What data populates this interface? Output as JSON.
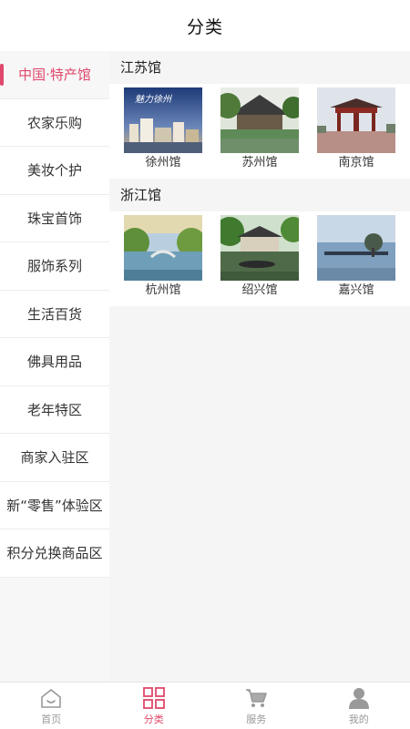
{
  "header": {
    "title": "分类"
  },
  "sidebar": {
    "items": [
      {
        "label": "中国·特产馆",
        "active": true
      },
      {
        "label": "农家乐购"
      },
      {
        "label": "美妆个护"
      },
      {
        "label": "珠宝首饰"
      },
      {
        "label": "服饰系列"
      },
      {
        "label": "生活百货"
      },
      {
        "label": "佛具用品"
      },
      {
        "label": "老年特区"
      },
      {
        "label": "商家入驻区"
      },
      {
        "label": "新“零售”体验区"
      },
      {
        "label": "积分兑换商品区"
      }
    ]
  },
  "sections": [
    {
      "title": "江苏馆",
      "items": [
        {
          "label": "徐州馆",
          "thumb_text": "魅力徐州"
        },
        {
          "label": "苏州馆"
        },
        {
          "label": "南京馆"
        }
      ]
    },
    {
      "title": "浙江馆",
      "items": [
        {
          "label": "杭州馆"
        },
        {
          "label": "绍兴馆"
        },
        {
          "label": "嘉兴馆"
        }
      ]
    }
  ],
  "tabbar": {
    "tabs": [
      {
        "label": "首页",
        "icon": "home-icon"
      },
      {
        "label": "分类",
        "icon": "category-icon",
        "active": true
      },
      {
        "label": "服务",
        "icon": "cart-icon"
      },
      {
        "label": "我的",
        "icon": "user-icon"
      }
    ]
  },
  "colors": {
    "accent": "#e0486c",
    "inactive": "#999999"
  }
}
